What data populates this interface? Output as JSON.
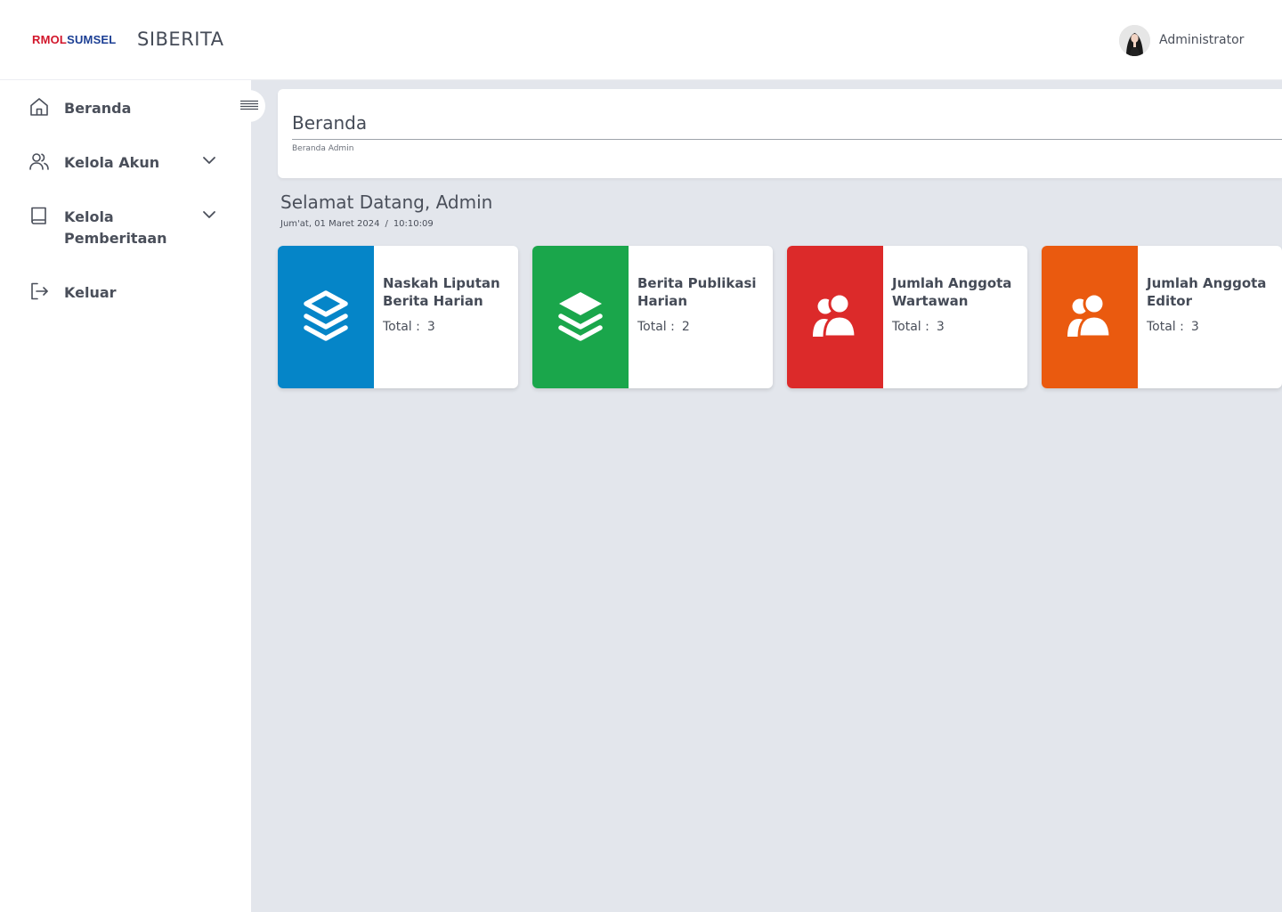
{
  "header": {
    "logo_part1": "RMOL",
    "logo_part2": "SUMSEL",
    "app_title": "SIBERITA",
    "user_name": "Administrator"
  },
  "sidebar": {
    "items": [
      {
        "label": "Beranda",
        "icon": "home-icon"
      },
      {
        "label": "Kelola Akun",
        "icon": "users-icon",
        "has_submenu": true
      },
      {
        "label": "Kelola Pemberitaan",
        "icon": "book-icon",
        "has_submenu": true
      },
      {
        "label": "Keluar",
        "icon": "logout-icon"
      }
    ]
  },
  "page": {
    "title": "Beranda",
    "subtitle": "Beranda Admin",
    "welcome": "Selamat Datang, Admin",
    "date": "Jum'at, 01 Maret 2024",
    "separator": "/",
    "time": "10:10:09"
  },
  "stats": [
    {
      "title": "Naskah Liputan Berita  Harian",
      "total_label": "Total :",
      "total": "3",
      "color": "#0585c8",
      "icon": "layers-icon"
    },
    {
      "title": "Berita Publikasi Harian",
      "total_label": "Total :",
      "total": "2",
      "color": "#1aa64b",
      "icon": "layers-icon"
    },
    {
      "title": "Jumlah Anggota Wartawan",
      "total_label": "Total :",
      "total": "3",
      "color": "#dc2a2a",
      "icon": "users-icon"
    },
    {
      "title": "Jumlah Anggota Editor",
      "total_label": "Total :",
      "total": "3",
      "color": "#ea5a0f",
      "icon": "users-icon"
    }
  ]
}
